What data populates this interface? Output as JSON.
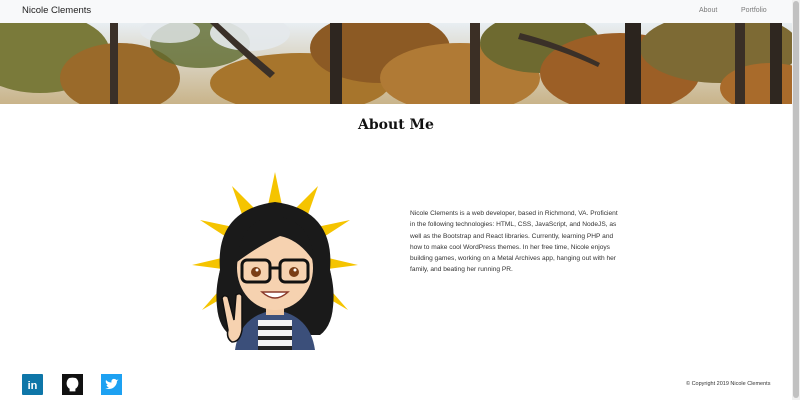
{
  "nav": {
    "brand": "Nicole Clements",
    "links": [
      "About",
      "Portfolio"
    ]
  },
  "about": {
    "title": "About Me",
    "bio": "Nicole Clements is a web developer, based in Richmond, VA. Proficient in the following technologies: HTML, CSS, JavaScript, and NodeJS, as well as the Bootstrap and React libraries. Currently, learning PHP and how to make cool WordPress themes. In her free time, Nicole enjoys building games, working on a Metal Archives app, hanging out with her family, and beating her running PR."
  },
  "social": {
    "icons": [
      "linkedin-icon",
      "github-icon",
      "twitter-icon"
    ],
    "linkedin_text": "in"
  },
  "footer": {
    "copyright": "© Copyright 2019 Nicole Clements"
  },
  "colors": {
    "linkedin": "#0e76a8",
    "github": "#111111",
    "twitter": "#1da1f2",
    "sun": "#f5c400"
  }
}
